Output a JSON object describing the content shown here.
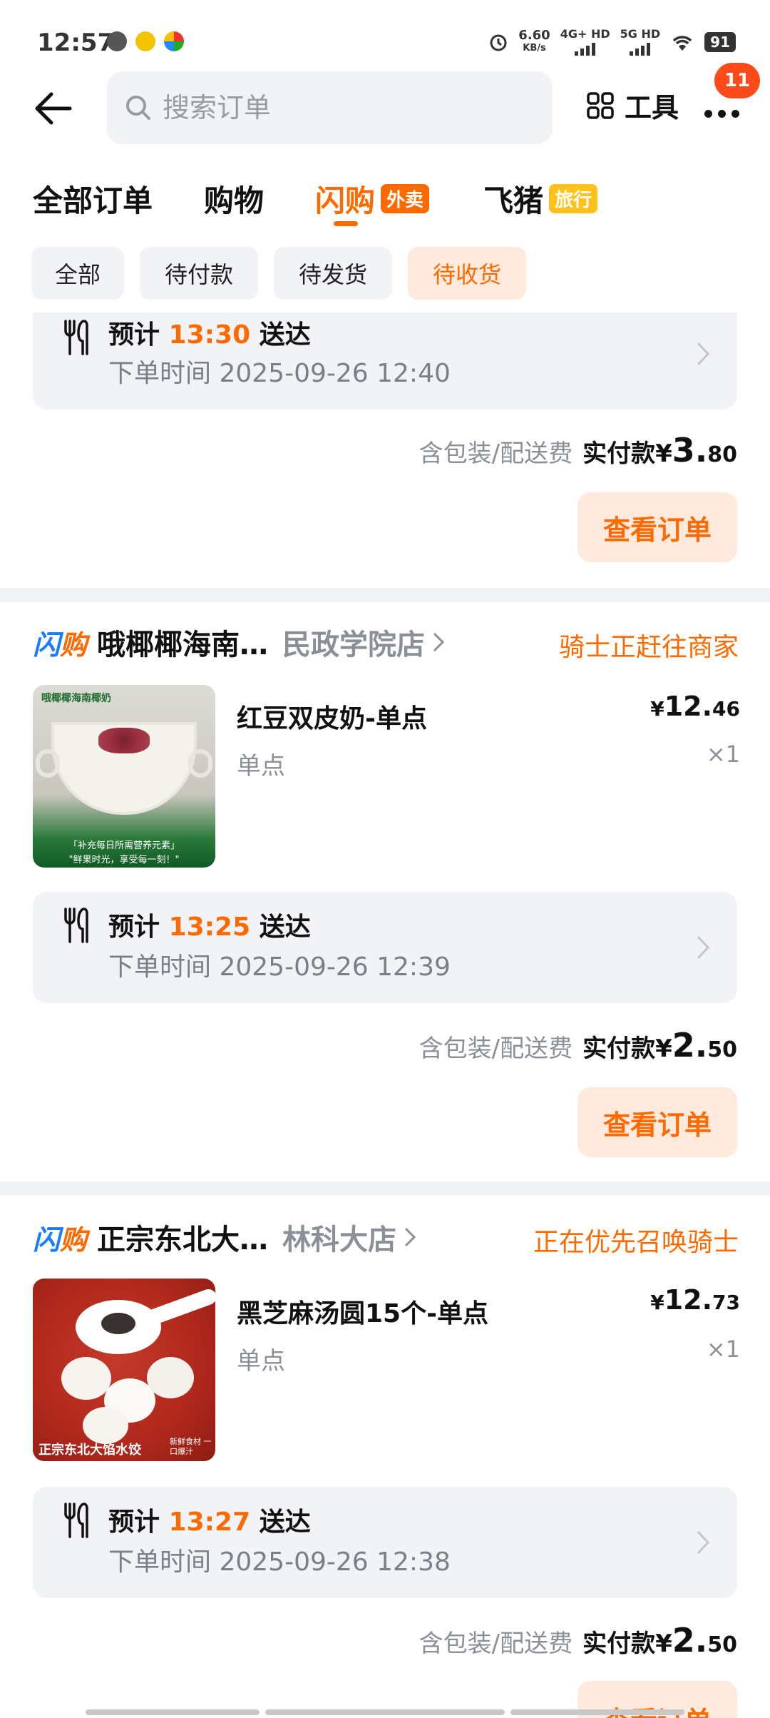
{
  "status_bar": {
    "time": "12:57",
    "net_speed": "6.60",
    "net_unit": "KB/s",
    "signal_1": "4G+ HD",
    "signal_2": "5G HD",
    "battery": "91"
  },
  "header": {
    "search_placeholder": "搜索订单",
    "tools_label": "工具",
    "more_badge": "11"
  },
  "tabs": [
    {
      "label": "全部订单"
    },
    {
      "label": "购物"
    },
    {
      "label": "闪购",
      "tag": "外卖",
      "tag_color": "#ff6a00",
      "active": true
    },
    {
      "label": "飞猪",
      "tag": "旅行",
      "tag_color": "#ffc21a"
    }
  ],
  "filters": [
    {
      "label": "全部"
    },
    {
      "label": "待付款"
    },
    {
      "label": "待发货"
    },
    {
      "label": "待收货",
      "active": true
    }
  ],
  "accent_color": "#ff6a00",
  "labels": {
    "eta_prefix": "预计",
    "eta_suffix": "送达",
    "order_time_prefix": "下单时间",
    "fee_note": "含包装/配送费",
    "paid_label": "实付款",
    "currency": "¥",
    "view_order": "查看订单",
    "brand_part1": "闪",
    "brand_part2": "购"
  },
  "orders": [
    {
      "eta": "13:30",
      "order_time": "2025-09-26 12:40",
      "paid_int": "3.",
      "paid_dec": "80"
    },
    {
      "store": "哦椰椰海南…",
      "branch": "民政学院店",
      "status": "骑士正赶往商家",
      "item_name": "红豆双皮奶-单点",
      "item_spec": "单点",
      "price_int": "12.",
      "price_dec": "46",
      "qty": "×1",
      "thumb_brand": "哦椰椰海南椰奶",
      "thumb_tag": "「补充每日所需营养元素」",
      "thumb_slogan": "\"鲜果时光，享受每一刻！\"",
      "eta": "13:25",
      "order_time": "2025-09-26 12:39",
      "paid_int": "2.",
      "paid_dec": "50"
    },
    {
      "store": "正宗东北大…",
      "branch": "林科大店",
      "status": "正在优先召唤骑士",
      "item_name": "黑芝麻汤圆15个-单点",
      "item_spec": "单点",
      "price_int": "12.",
      "price_dec": "73",
      "qty": "×1",
      "thumb_brand": "正宗东北大馅水饺",
      "thumb_side": "新鲜食材 一口爆汁",
      "eta": "13:27",
      "order_time": "2025-09-26 12:38",
      "paid_int": "2.",
      "paid_dec": "50"
    }
  ]
}
